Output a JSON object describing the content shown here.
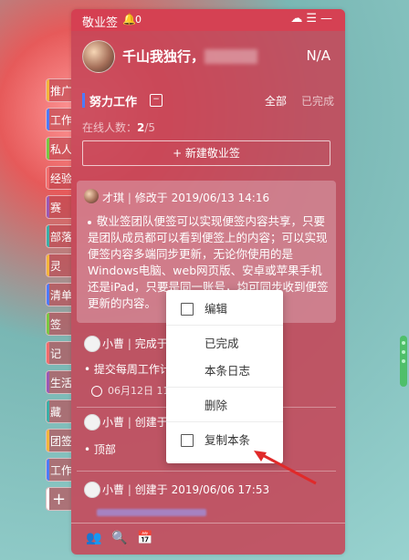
{
  "left_tabs": [
    {
      "label": "推广",
      "color": "#f4b73b"
    },
    {
      "label": "工作",
      "color": "#4d7bff"
    },
    {
      "label": "私人",
      "color": "#7ac943"
    },
    {
      "label": "经验",
      "color": "#f26d6d"
    },
    {
      "label": "赛",
      "color": "#9b59b6"
    },
    {
      "label": "部落",
      "color": "#3ab0a8"
    },
    {
      "label": "灵",
      "color": "#f4b73b"
    },
    {
      "label": "清单",
      "color": "#4d7bff"
    },
    {
      "label": "签",
      "color": "#7ac943"
    },
    {
      "label": "记",
      "color": "#f26d6d"
    },
    {
      "label": "生活",
      "color": "#9b59b6"
    },
    {
      "label": "藏",
      "color": "#3ab0a8"
    },
    {
      "label": "团签",
      "color": "#f4b73b"
    },
    {
      "label": "工作",
      "color": "#4d7bff"
    },
    {
      "label": "+",
      "color": "#ffffff"
    }
  ],
  "titlebar": {
    "title": "敬业签",
    "notifications": "0",
    "icons": [
      "cloud-icon",
      "menu-icon",
      "close-icon"
    ]
  },
  "header": {
    "username": "千山我独行，",
    "status": "N/A"
  },
  "section": {
    "title": "努力工作",
    "filter_all": "全部",
    "filter_done": "已完成"
  },
  "online": {
    "label": "在线人数：",
    "count": "2",
    "total": "/5"
  },
  "new_note_button": "+ 新建敬业签",
  "notes": [
    {
      "author": "才琪",
      "action": "修改于",
      "time": "2019/06/13 14:16",
      "content": "敬业签团队便签可以实现便签内容共享，只要是团队成员都可以看到便签上的内容；可以实现便签内容多端同步更新，无论你使用的是Windows电脑、web网页版、安卓或苹果手机还是iPad，只要是同一账号，均可同步收到便签更新的内容。"
    },
    {
      "author": "小曹",
      "action": "完成于",
      "time": "",
      "bullet": "提交每周工作计",
      "sub": "06月12日 11:2"
    },
    {
      "author": "小曹",
      "action": "创建于",
      "time": "",
      "bullet": "顶部"
    },
    {
      "author": "小曹",
      "action": "创建于",
      "time": "2019/06/06 17:53"
    }
  ],
  "context_menu": {
    "items": [
      "编辑",
      "已完成",
      "本条日志",
      "删除",
      "复制本条"
    ]
  },
  "footer": {
    "icons": [
      "people-icon",
      "search-icon",
      "calendar-icon"
    ]
  },
  "colors": {
    "window": "#c64658",
    "accent": "#4d7bff",
    "handle": "#4fbf6a",
    "arrow": "#e02a2a"
  }
}
